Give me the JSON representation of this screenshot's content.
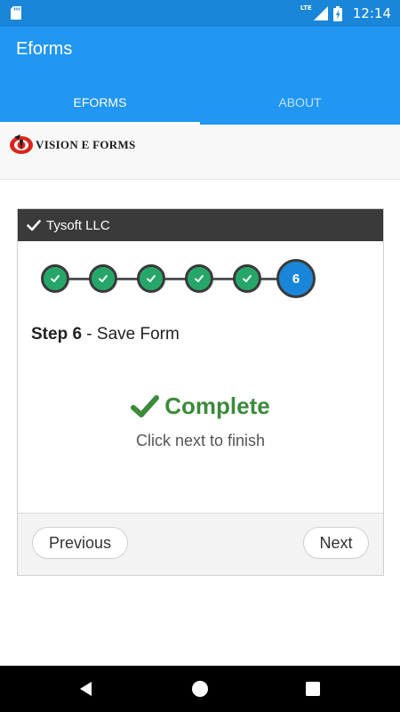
{
  "status_bar": {
    "network": "LTE",
    "time": "12:14",
    "background": "#1a86d9"
  },
  "app_bar": {
    "title": "Eforms",
    "color": "#2196f3"
  },
  "tabs": [
    {
      "label": "EFORMS",
      "selected": true
    },
    {
      "label": "ABOUT",
      "selected": false
    }
  ],
  "logo": {
    "text": "VISION E FORMS",
    "icon": "vision-logo-icon"
  },
  "panel": {
    "header_title": "Tysoft LLC",
    "header_icon": "check-icon",
    "stepper": {
      "completed_steps": 5,
      "current_step": "6",
      "completed_color": "#27a66a",
      "current_color": "#1a86d9"
    },
    "step_heading_bold": "Step 6",
    "step_heading_rest": " - Save Form",
    "status_icon": "check-icon",
    "status_text": "Complete",
    "status_color": "#3c8a3c",
    "status_message": "Click next to finish",
    "previous_label": "Previous",
    "next_label": "Next"
  },
  "nav_bar": {
    "back_icon": "back-triangle-icon",
    "home_icon": "home-circle-icon",
    "recents_icon": "recents-square-icon"
  }
}
